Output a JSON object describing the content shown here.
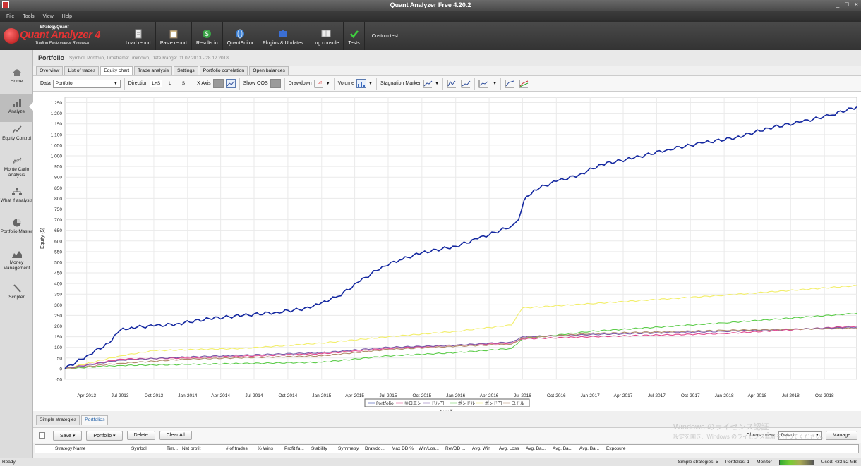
{
  "window": {
    "title": "Quant Analyzer Free 4.20.2",
    "controls": [
      "_",
      "□",
      "×"
    ]
  },
  "menu": [
    "File",
    "Tools",
    "View",
    "Help"
  ],
  "logo": {
    "top": "StrategyQuant",
    "name": "Quant Analyzer",
    "version": "4",
    "sub": "Trading Performance    Research"
  },
  "toolbar": [
    {
      "label": "Load report",
      "icon": "document-icon"
    },
    {
      "label": "Paste report",
      "icon": "clipboard-icon"
    },
    {
      "label": "Results in",
      "icon": "dollar-icon"
    },
    {
      "label": "QuantEditor",
      "icon": "globe-icon"
    },
    {
      "label": "Plugins & Updates",
      "icon": "puzzle-icon"
    },
    {
      "label": "Log console",
      "icon": "console-icon"
    },
    {
      "label": "Tests",
      "icon": "checkmark-icon"
    }
  ],
  "toolbar_custom": "Custom test",
  "nav": [
    {
      "label": "Home",
      "icon": "home-icon"
    },
    {
      "label": "Analyze",
      "icon": "analyze-icon"
    },
    {
      "label": "Equity Control",
      "icon": "equity-control-icon"
    },
    {
      "label": "Monte Carlo analysis",
      "icon": "monte-carlo-icon"
    },
    {
      "label": "What if analysis",
      "icon": "what-if-icon"
    },
    {
      "label": "Portfolio Master",
      "icon": "portfolio-master-icon"
    },
    {
      "label": "Money Management",
      "icon": "money-management-icon"
    },
    {
      "label": "Scripter",
      "icon": "scripter-icon"
    }
  ],
  "portfolio": {
    "title": "Portfolio",
    "info": "Symbol: Portfolio, Timeframe: unknown, Date Range: 01.02.2013 - 28.12.2018"
  },
  "tabs": [
    "Overview",
    "List of trades",
    "Equity chart",
    "Trade analysis",
    "Settings",
    "Portfolio correlation",
    "Open balances"
  ],
  "controls": {
    "data_label": "Data",
    "data_value": "Portfolio",
    "direction_label": "Direction",
    "dir_ls": "L+S",
    "dir_l": "L",
    "dir_s": "S",
    "xaxis_label": "X Axis",
    "show_oos_label": "Show OOS",
    "drawdown_label": "Drawdown",
    "volume_label": "Volume",
    "stagnation_label": "Stagnation Marker"
  },
  "chart_data": {
    "type": "line",
    "ylabel": "Equity ($)",
    "ylim": [
      -50,
      1275
    ],
    "yticks": [
      1250,
      1200,
      1150,
      1100,
      1050,
      1000,
      950,
      900,
      850,
      800,
      750,
      700,
      650,
      600,
      550,
      500,
      450,
      400,
      350,
      300,
      250,
      200,
      150,
      100,
      50,
      0,
      -50
    ],
    "x_labels": [
      "Apr-2013",
      "Jul-2013",
      "Oct-2013",
      "Jan-2014",
      "Apr-2014",
      "Jul-2014",
      "Oct-2014",
      "Jan-2015",
      "Apr-2015",
      "Jul-2015",
      "Oct-2015",
      "Jan-2016",
      "Apr-2016",
      "Jul-2016",
      "Oct-2016",
      "Jan-2017",
      "Apr-2017",
      "Jul-2017",
      "Oct-2017",
      "Jan-2018",
      "Apr-2018",
      "Jul-2018",
      "Oct-2018"
    ],
    "x_label_dates": [
      "2013-04-01",
      "2013-07-01",
      "2013-10-01",
      "2014-01-01",
      "2014-04-01",
      "2014-07-01",
      "2014-10-01",
      "2015-01-01",
      "2015-04-01",
      "2015-07-01",
      "2015-10-01",
      "2016-01-01",
      "2016-04-01",
      "2016-07-01",
      "2016-10-01",
      "2017-01-01",
      "2017-04-01",
      "2017-07-01",
      "2017-10-01",
      "2018-01-01",
      "2018-04-01",
      "2018-07-01",
      "2018-10-01"
    ],
    "grid": true,
    "legend_position": "bottom",
    "series": [
      {
        "name": "Portfolio",
        "color": "#1428a0",
        "x": [
          "2013-02-01",
          "2013-04-01",
          "2013-06-01",
          "2013-07-01",
          "2013-08-01",
          "2013-10-01",
          "2013-12-01",
          "2014-03-01",
          "2014-06-01",
          "2014-09-01",
          "2014-12-01",
          "2015-01-01",
          "2015-02-15",
          "2015-04-15",
          "2015-06-15",
          "2015-08-01",
          "2015-10-01",
          "2016-01-01",
          "2016-03-01",
          "2016-06-01",
          "2016-06-20",
          "2016-07-05",
          "2016-08-01",
          "2016-10-01",
          "2016-12-01",
          "2017-02-01",
          "2017-05-01",
          "2017-08-01",
          "2017-11-01",
          "2018-02-01",
          "2018-05-01",
          "2018-08-01",
          "2018-10-15",
          "2018-12-28"
        ],
        "values": [
          0,
          60,
          120,
          180,
          195,
          200,
          210,
          235,
          250,
          265,
          285,
          310,
          340,
          410,
          480,
          510,
          545,
          575,
          610,
          670,
          700,
          790,
          840,
          880,
          910,
          960,
          990,
          1030,
          1060,
          1085,
          1130,
          1160,
          1190,
          1230
        ]
      },
      {
        "name": "ゆロエン",
        "color": "#e0458c",
        "x": [
          "2013-02-01",
          "2013-07-01",
          "2014-01-01",
          "2015-01-01",
          "2015-07-01",
          "2016-01-01",
          "2016-06-01",
          "2016-07-01",
          "2017-01-01",
          "2018-01-01",
          "2018-12-28"
        ],
        "values": [
          0,
          45,
          50,
          70,
          95,
          110,
          120,
          140,
          150,
          165,
          200
        ]
      },
      {
        "name": "ドル円",
        "color": "#7a5aa8",
        "x": [
          "2013-02-01",
          "2013-07-01",
          "2014-01-01",
          "2015-01-01",
          "2015-07-01",
          "2016-01-01",
          "2016-06-01",
          "2016-07-01",
          "2017-01-01",
          "2018-01-01",
          "2018-12-28"
        ],
        "values": [
          0,
          40,
          55,
          75,
          100,
          110,
          125,
          150,
          160,
          175,
          195
        ]
      },
      {
        "name": "ポンドル",
        "color": "#5ccc4a",
        "x": [
          "2013-02-01",
          "2013-07-01",
          "2014-01-01",
          "2015-01-01",
          "2015-07-01",
          "2016-01-01",
          "2016-06-01",
          "2016-07-01",
          "2017-01-01",
          "2018-01-01",
          "2018-12-28"
        ],
        "values": [
          0,
          15,
          20,
          30,
          60,
          75,
          95,
          140,
          175,
          215,
          260
        ]
      },
      {
        "name": "ポンド円",
        "color": "#f2ee6a",
        "x": [
          "2013-02-01",
          "2013-07-01",
          "2013-10-01",
          "2014-06-01",
          "2015-01-01",
          "2015-07-01",
          "2016-01-01",
          "2016-06-01",
          "2016-07-01",
          "2017-01-01",
          "2018-01-01",
          "2018-12-28"
        ],
        "values": [
          0,
          60,
          85,
          95,
          120,
          150,
          175,
          205,
          285,
          305,
          345,
          390
        ]
      },
      {
        "name": "ユドル",
        "color": "#b08a6a",
        "x": [
          "2013-02-01",
          "2013-07-01",
          "2014-01-01",
          "2015-01-01",
          "2015-07-01",
          "2016-01-01",
          "2016-06-01",
          "2016-07-01",
          "2017-01-01",
          "2018-01-01",
          "2018-12-28"
        ],
        "values": [
          0,
          25,
          45,
          60,
          90,
          105,
          115,
          145,
          165,
          180,
          190
        ]
      }
    ]
  },
  "bottom_tabs": [
    "Simple strategies",
    "Portfolios"
  ],
  "bottom_buttons": {
    "save": "Save ▾",
    "portfolio": "Portfolio ▾",
    "delete": "Delete",
    "clear_all": "Clear All",
    "choose_view": "Choose view",
    "view_value": "Default",
    "manage": "Manage"
  },
  "watermark": {
    "line1": "Windows のライセンス認証",
    "line2": "設定を開き、Windows のライセンス認証を行ってください。"
  },
  "table_columns": [
    "Strategy Name",
    "Symbol",
    "Tim...",
    "Net profit",
    "# of trades",
    "% Wins",
    "Profit fa...",
    "Stability",
    "Symmetry",
    "Drawdo...",
    "Max DD %",
    "Win/Los...",
    "Ret/DD ...",
    "Avg. Win",
    "Avg. Loss",
    "Avg. Ba...",
    "Avg. Ba...",
    "Avg. Ba...",
    "Exposure"
  ],
  "status": {
    "ready": "Ready",
    "simple_label": "Simple strategies:",
    "simple_count": "5",
    "portfolios_label": "Portfolios:",
    "portfolios_count": "1",
    "monitor_label": "Monitor",
    "memory": "Used: 433.52 MB"
  }
}
